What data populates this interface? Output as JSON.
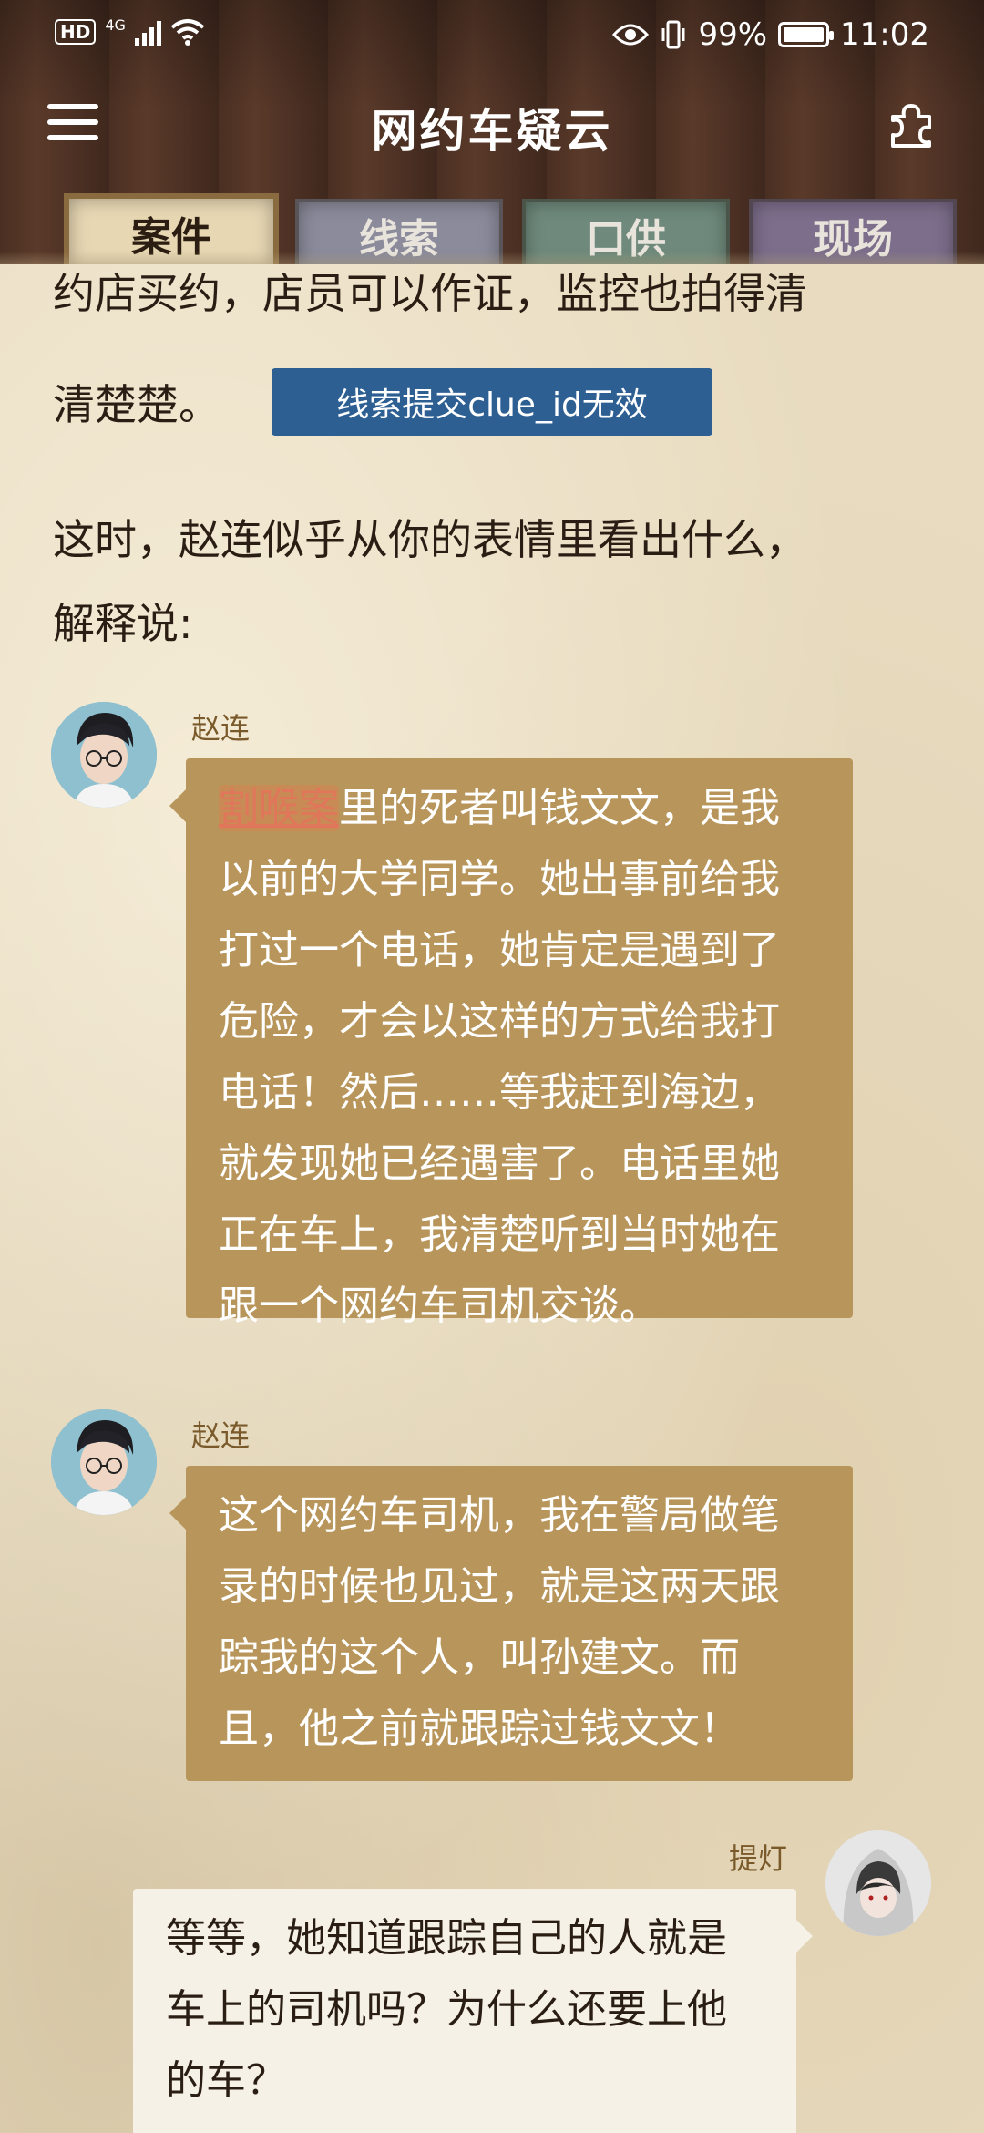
{
  "status_bar": {
    "hd": "HD",
    "network": "4G",
    "battery": "99%",
    "time": "11:02"
  },
  "app": {
    "title": "网约车疑云"
  },
  "tabs": [
    {
      "label": "案件",
      "active": true
    },
    {
      "label": "线索",
      "active": false
    },
    {
      "label": "口供",
      "active": false
    },
    {
      "label": "现场",
      "active": false
    }
  ],
  "narration": {
    "cut_line": "约店买约，店员可以作证，监控也拍得清",
    "line2": "清楚楚。",
    "error_button": "线索提交clue_id无效",
    "p2_line1": "这时，赵连似乎从你的表情里看出什么，",
    "p2_line2": "解释说:"
  },
  "messages": [
    {
      "speaker": "赵连",
      "highlight": "割喉案",
      "lines": [
        "里的死者叫钱文文，是我",
        "以前的大学同学。她出事前给我",
        "打过一个电话，她肯定是遇到了",
        "危险，才会以这样的方式给我打",
        "电话！然后……等我赶到海边，",
        "就发现她已经遇害了。电话里她",
        "正在车上，我清楚听到当时她在",
        "跟一个网约车司机交谈。"
      ]
    },
    {
      "speaker": "赵连",
      "lines": [
        "这个网约车司机，我在警局做笔",
        "录的时候也见过，就是这两天跟",
        "踪我的这个人，叫孙建文。而",
        "且，他之前就跟踪过钱文文！"
      ]
    },
    {
      "speaker": "提灯",
      "lines": [
        "等等，她知道跟踪自己的人就是",
        "车上的司机吗？为什么还要上他",
        "的车？"
      ]
    }
  ]
}
